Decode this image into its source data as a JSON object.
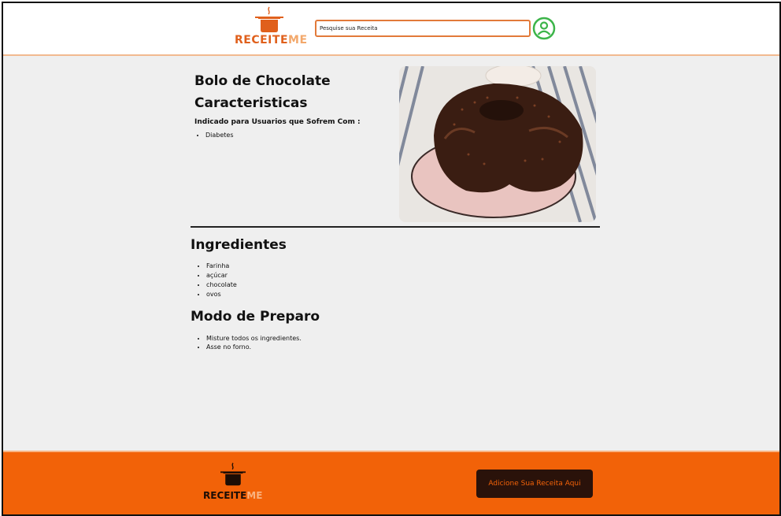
{
  "header": {
    "logo": {
      "part1": "RECEITE",
      "part2": "ME"
    },
    "search": {
      "placeholder": "Pesquise sua Receita"
    },
    "user_icon": "user-circle-icon"
  },
  "recipe": {
    "title": "Bolo de Chocolate",
    "features_title": "Caracteristicas",
    "indicated_label": "Indicado para Usuarios que Sofrem Com :",
    "conditions": [
      "Diabetes"
    ],
    "image": "chocolate-cake-photo",
    "ingredients_title": "Ingredientes",
    "ingredients": [
      "Farinha",
      "açúcar",
      "chocolate",
      "ovos"
    ],
    "prep_title": "Modo de Preparo",
    "steps": [
      "Misture todos os ingredientes.",
      "Asse no forno."
    ]
  },
  "footer": {
    "logo": {
      "part1": "RECEITE",
      "part2": "ME"
    },
    "cta_label": "Adicione Sua Receita Aqui"
  },
  "colors": {
    "brand_orange": "#f26208",
    "header_accent": "#e27a3a",
    "user_icon_green": "#3db54a",
    "cta_bg": "#2a120a"
  }
}
